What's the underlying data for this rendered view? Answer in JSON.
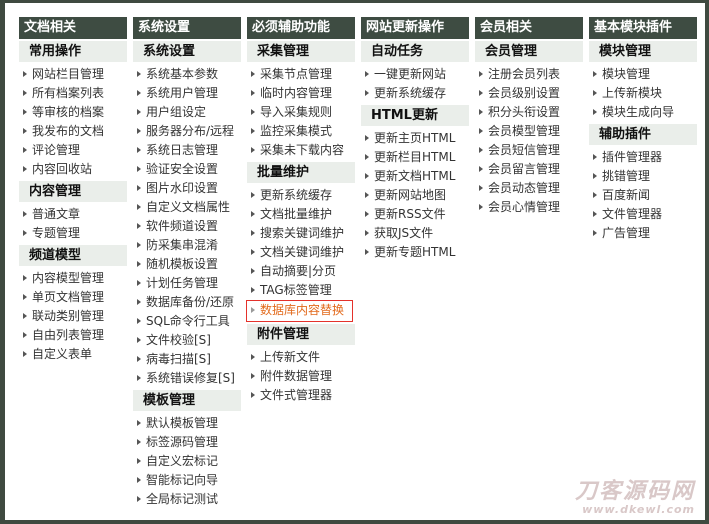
{
  "columns": [
    {
      "title": "文档相关",
      "sections": [
        {
          "title": "常用操作",
          "items": [
            "网站栏目管理",
            "所有档案列表",
            "等审核的档案",
            "我发布的文档",
            "评论管理",
            "内容回收站"
          ]
        },
        {
          "title": "内容管理",
          "items": [
            "普通文章",
            "专题管理"
          ]
        },
        {
          "title": "频道模型",
          "items": [
            "内容模型管理",
            "单页文档管理",
            "联动类别管理",
            "自由列表管理",
            "自定义表单"
          ]
        }
      ]
    },
    {
      "title": "系统设置",
      "sections": [
        {
          "title": "系统设置",
          "items": [
            "系统基本参数",
            "系统用户管理",
            "用户组设定",
            "服务器分布/远程",
            "系统日志管理",
            "验证安全设置",
            "图片水印设置",
            "自定义文档属性",
            "软件频道设置",
            "防采集串混淆",
            "随机模板设置",
            "计划任务管理",
            "数据库备份/还原",
            "SQL命令行工具",
            "文件校验[S]",
            "病毒扫描[S]",
            "系统错误修复[S]"
          ]
        },
        {
          "title": "模板管理",
          "items": [
            "默认模板管理",
            "标签源码管理",
            "自定义宏标记",
            "智能标记向导",
            "全局标记测试"
          ]
        }
      ]
    },
    {
      "title": "必须辅助功能",
      "sections": [
        {
          "title": "采集管理",
          "items": [
            "采集节点管理",
            "临时内容管理",
            "导入采集规则",
            "监控采集模式",
            "采集未下载内容"
          ]
        },
        {
          "title": "批量维护",
          "items": [
            "更新系统缓存",
            "文档批量维护",
            "搜索关键词维护",
            "文档关键词维护",
            "自动摘要|分页",
            "TAG标签管理",
            "数据库内容替换"
          ],
          "highlight_index": 6
        },
        {
          "title": "附件管理",
          "items": [
            "上传新文件",
            "附件数据管理",
            "文件式管理器"
          ]
        }
      ]
    },
    {
      "title": "网站更新操作",
      "sections": [
        {
          "title": "自动任务",
          "items": [
            "一键更新网站",
            "更新系统缓存"
          ]
        },
        {
          "title": "HTML更新",
          "items": [
            "更新主页HTML",
            "更新栏目HTML",
            "更新文档HTML",
            "更新网站地图",
            "更新RSS文件",
            "获取JS文件",
            "更新专题HTML"
          ]
        }
      ]
    },
    {
      "title": "会员相关",
      "sections": [
        {
          "title": "会员管理",
          "items": [
            "注册会员列表",
            "会员级别设置",
            "积分头衔设置",
            "会员模型管理",
            "会员短信管理",
            "会员留言管理",
            "会员动态管理",
            "会员心情管理"
          ]
        }
      ]
    },
    {
      "title": "基本模块插件",
      "sections": [
        {
          "title": "模块管理",
          "items": [
            "模块管理",
            "上传新模块",
            "模块生成向导"
          ]
        },
        {
          "title": "辅助插件",
          "items": [
            "插件管理器",
            "挑错管理",
            "百度新闻",
            "文件管理器",
            "广告管理"
          ]
        }
      ]
    }
  ],
  "watermark": {
    "main": "刀客源码网",
    "url": "www.dkewl.com"
  },
  "colors": {
    "header_bg": "#3e4c42",
    "section_bg": "#eaeeea",
    "highlight_border": "#e4322b",
    "highlight_text": "#e26a1c"
  }
}
